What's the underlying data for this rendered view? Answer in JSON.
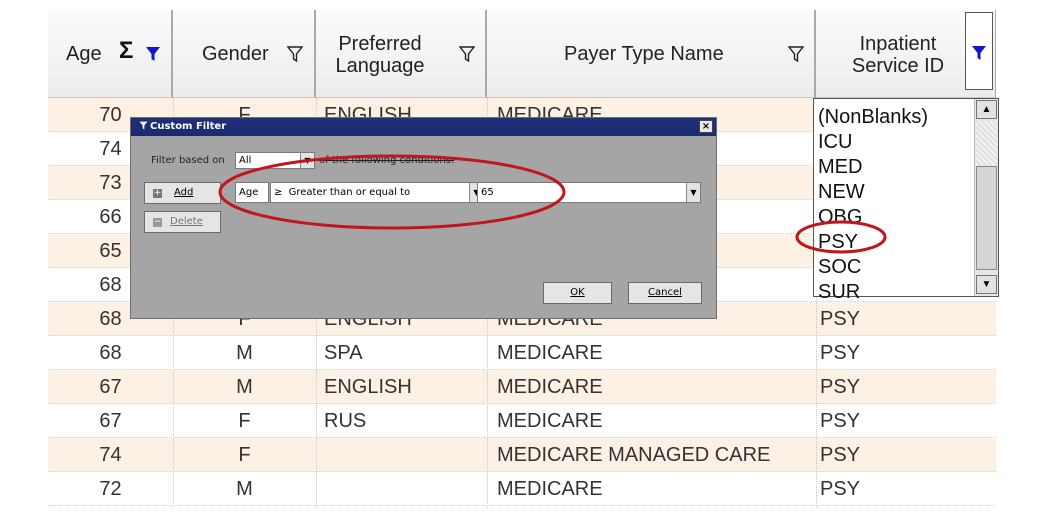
{
  "headers": {
    "age": "Age",
    "gender": "Gender",
    "language": "Preferred\nLanguage",
    "payer": "Payer Type Name",
    "inpatient": "Inpatient\nService ID",
    "sigma": "Σ"
  },
  "rows": [
    {
      "age": "70",
      "gender": "F",
      "language": "ENGLISH",
      "payer": "MEDICARE",
      "service": ""
    },
    {
      "age": "74",
      "gender": "",
      "language": "",
      "payer": "",
      "service": ""
    },
    {
      "age": "73",
      "gender": "",
      "language": "",
      "payer": "",
      "service": ""
    },
    {
      "age": "66",
      "gender": "",
      "language": "",
      "payer": "",
      "service": ""
    },
    {
      "age": "65",
      "gender": "",
      "language": "",
      "payer": "",
      "service": ""
    },
    {
      "age": "68",
      "gender": "",
      "language": "",
      "payer": "",
      "service": ""
    },
    {
      "age": "68",
      "gender": "F",
      "language": "ENGLISH",
      "payer": "MEDICARE",
      "service": "PSY"
    },
    {
      "age": "68",
      "gender": "M",
      "language": "SPA",
      "payer": "MEDICARE",
      "service": "PSY"
    },
    {
      "age": "67",
      "gender": "M",
      "language": "ENGLISH",
      "payer": "MEDICARE",
      "service": "PSY"
    },
    {
      "age": "67",
      "gender": "F",
      "language": "RUS",
      "payer": "MEDICARE",
      "service": "PSY"
    },
    {
      "age": "74",
      "gender": "F",
      "language": "",
      "payer": "MEDICARE MANAGED CARE",
      "service": "PSY"
    },
    {
      "age": "72",
      "gender": "M",
      "language": "",
      "payer": "MEDICARE",
      "service": "PSY"
    }
  ],
  "dialog": {
    "title": "Custom Filter",
    "close": "×",
    "filter_based_on_label": "Filter based on",
    "filter_based_on_value": "All",
    "conditions_text": "of the following conditions:",
    "add_label": "Add",
    "delete_label": "Delete",
    "field": "Age",
    "operator_symbol": "≥",
    "operator_text": "Greater than or equal to",
    "value": "65",
    "ok_label": "OK",
    "cancel_label": "Cancel"
  },
  "dropdown": {
    "items": [
      "(NonBlanks)",
      "ICU",
      "MED",
      "NEW",
      "OBG",
      "PSY",
      "SOC",
      "SUR"
    ]
  },
  "colors": {
    "alt_row": "#fdf0e4",
    "dialog_title": "#1a2a6d",
    "highlight_ellipse": "#c0161c",
    "active_filter_icon": "#1515c8"
  }
}
